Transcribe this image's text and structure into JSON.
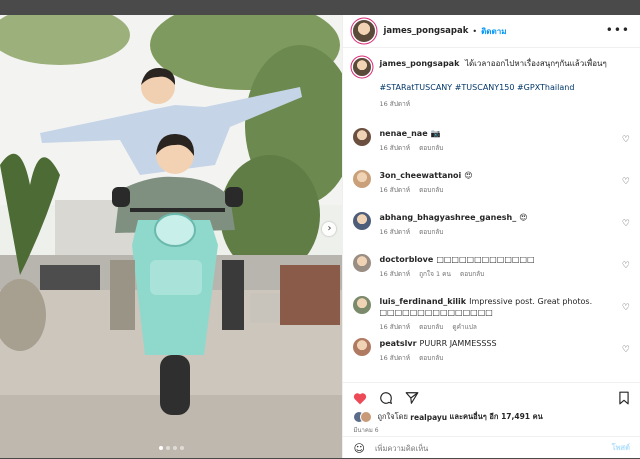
{
  "post": {
    "username": "james_pongsapak",
    "separator": "•",
    "follow_label": "ติดตาม",
    "more_label": "•••",
    "caption": "ได้เวลาออกไปหาเรื่องสนุกๆกันแล้วเพื่อนๆ",
    "hashtags": "#STARatTUSCANY #TUSCANY150 #GPXThailand",
    "caption_time": "16 สัปดาห์",
    "photo_dots": 4
  },
  "comments": [
    {
      "user": "nenae_nae",
      "text": "📷",
      "time": "16 สัปดาห์",
      "likes": "",
      "reply": "ตอบกลับ",
      "translate": ""
    },
    {
      "user": "3on_cheewattanoi",
      "text": "😍",
      "time": "16 สัปดาห์",
      "likes": "",
      "reply": "ตอบกลับ",
      "translate": ""
    },
    {
      "user": "abhang_bhagyashree_ganesh_",
      "text": "😍",
      "time": "16 สัปดาห์",
      "likes": "",
      "reply": "ตอบกลับ",
      "translate": ""
    },
    {
      "user": "doctorblove",
      "text": "□□□□□□□□□□□□□",
      "time": "16 สัปดาห์",
      "likes": "ถูกใจ 1 คน",
      "reply": "ตอบกลับ",
      "translate": ""
    },
    {
      "user": "luis_ferdinand_kilik",
      "text": "Impressive post. Great photos. □□□□□□□□□□□□□□□",
      "time": "16 สัปดาห์",
      "likes": "",
      "reply": "ตอบกลับ",
      "translate": "ดูคำแปล"
    },
    {
      "user": "peatslvr",
      "text": "PUURR JAMMESSSS",
      "time": "16 สัปดาห์",
      "likes": "",
      "reply": "ตอบกลับ",
      "translate": ""
    }
  ],
  "likes": {
    "text_prefix": "ถูกใจโดย",
    "liker": "realpayu",
    "text_suffix": "และคนอื่นๆ อีก 17,491 คน"
  },
  "date": "มีนาคม 6",
  "add_comment": {
    "placeholder": "เพิ่มความคิดเห็น",
    "post_label": "โพสต์"
  },
  "colors": {
    "heart": "#ed4956",
    "link": "#0095f6",
    "scooter": "#8fd8cc"
  },
  "icons": [
    "heart-icon",
    "comment-icon",
    "share-icon",
    "bookmark-icon",
    "emoji-icon",
    "chevron-right-icon"
  ]
}
